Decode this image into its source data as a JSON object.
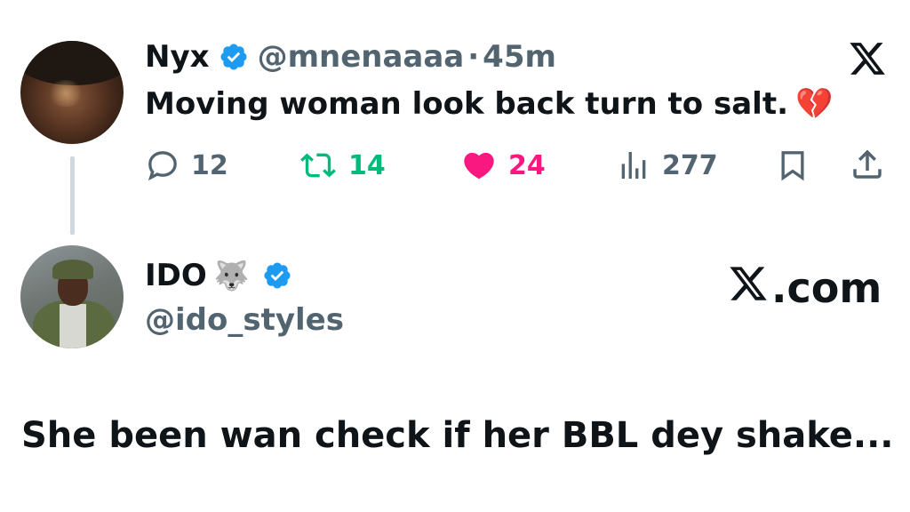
{
  "quoted_tweet": {
    "name": "Nyx",
    "handle": "@mnenaaaa",
    "separator": "·",
    "time": "45m",
    "text": "Moving woman look back turn to salt.",
    "emoji": "💔",
    "replies": "12",
    "retweets": "14",
    "likes": "24",
    "views": "277"
  },
  "reply_tweet": {
    "name": "IDO",
    "name_emoji": "🐺",
    "handle": "@ido_styles",
    "text": "She been wan check if her BBL dey shake..."
  },
  "branding": {
    "xcom_suffix": ".com"
  },
  "colors": {
    "verified": "#1d9bf0",
    "retweet": "#00ba7c",
    "like": "#f91880",
    "muted": "#536471"
  }
}
